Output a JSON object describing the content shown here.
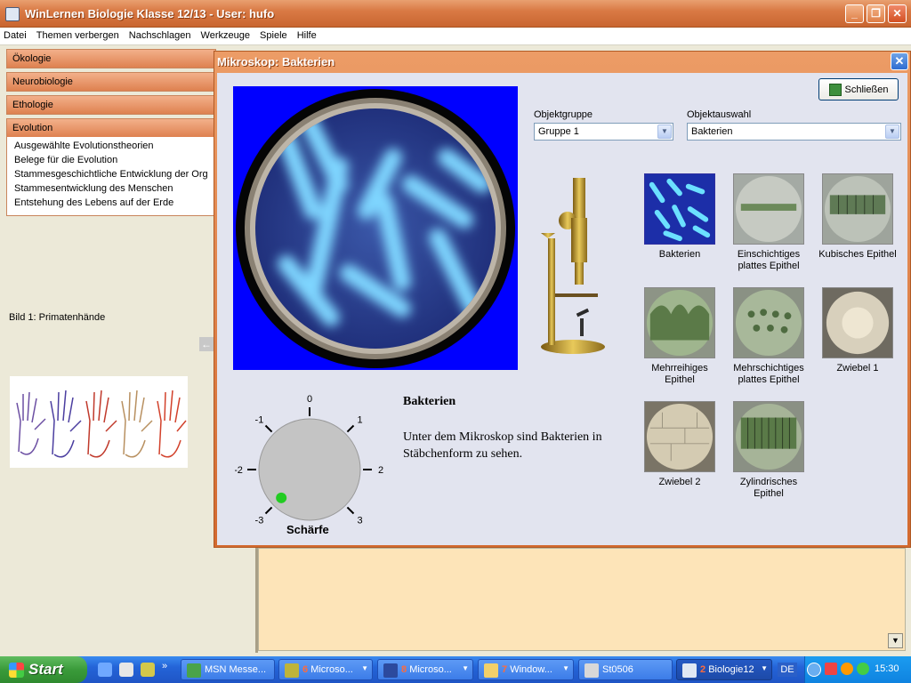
{
  "window": {
    "title": "WinLernen Biologie Klasse 12/13 - User: hufo"
  },
  "menu": [
    "Datei",
    "Themen verbergen",
    "Nachschlagen",
    "Werkzeuge",
    "Spiele",
    "Hilfe"
  ],
  "sidebar": {
    "sections": [
      "Ökologie",
      "Neurobiologie",
      "Ethologie",
      "Evolution"
    ],
    "evolution_items": [
      "Ausgewählte Evolutionstheorien",
      "Belege für die Evolution",
      "Stammesgeschichtliche Entwicklung der Organismen",
      "Stammesentwicklung des Menschen",
      "Entstehung des Lebens auf der Erde"
    ],
    "image_caption": "Bild 1: Primatenhände"
  },
  "dialog": {
    "title": "Mikroskop: Bakterien",
    "close_button": "Schließen",
    "group_label": "Objektgruppe",
    "group_value": "Gruppe 1",
    "object_label": "Objektauswahl",
    "object_value": "Bakterien",
    "thumbnails": [
      {
        "label": "Bakterien",
        "selected": true
      },
      {
        "label": "Einschichtiges plattes Epithel"
      },
      {
        "label": "Kubisches Epithel"
      },
      {
        "label": "Mehrreihiges Epithel"
      },
      {
        "label": "Mehrschichtiges plattes Epithel"
      },
      {
        "label": "Zwiebel 1"
      },
      {
        "label": "Zwiebel 2"
      },
      {
        "label": "Zylindrisches Epithel"
      }
    ],
    "object_title": "Bakterien",
    "object_description": "Unter dem Mikroskop sind Bakterien in Stäbchenform zu sehen.",
    "dial": {
      "label": "Schärfe",
      "ticks": [
        "-3",
        "-2",
        "-1",
        "0",
        "1",
        "2",
        "3"
      ],
      "value": -3
    }
  },
  "taskbar": {
    "start": "Start",
    "tasks": [
      {
        "num": "",
        "label": "MSN Messe..."
      },
      {
        "num": "6",
        "label": "Microso..."
      },
      {
        "num": "8",
        "label": "Microso..."
      },
      {
        "num": "7",
        "label": "Window..."
      },
      {
        "num": "",
        "label": "St0506"
      },
      {
        "num": "2",
        "label": "Biologie12"
      }
    ],
    "language": "DE",
    "clock": "15:30"
  },
  "colors": {
    "titlebar": "#d97a45",
    "dialog_body": "#e2e4ef",
    "scope_bg": "#0000ff",
    "dial_indicator": "#22cc22"
  }
}
